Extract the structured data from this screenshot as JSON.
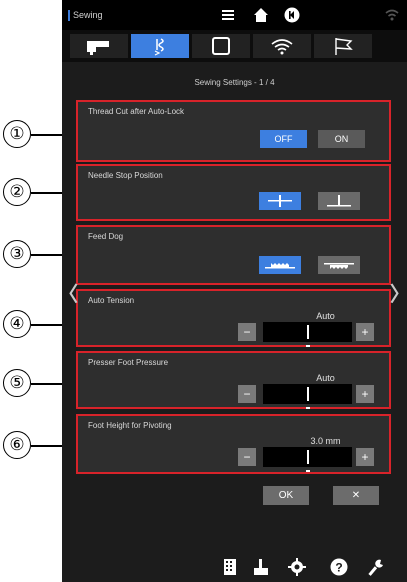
{
  "app": {
    "title": "Sewing"
  },
  "subtitle": "Sewing Settings - 1 / 4",
  "settings": {
    "thread_cut": {
      "label": "Thread Cut after Auto-Lock",
      "off_label": "OFF",
      "on_label": "ON",
      "selected": "OFF"
    },
    "needle_stop": {
      "label": "Needle Stop Position",
      "selected": "up"
    },
    "feed_dog": {
      "label": "Feed Dog",
      "selected": "up"
    },
    "auto_tension": {
      "label": "Auto Tension",
      "value": "Auto",
      "minus": "−",
      "plus": "+"
    },
    "presser_foot": {
      "label": "Presser Foot Pressure",
      "value": "Auto",
      "minus": "−",
      "plus": "+"
    },
    "foot_height": {
      "label": "Foot Height for Pivoting",
      "value": "3.0 mm",
      "minus": "−",
      "plus": "+"
    }
  },
  "buttons": {
    "ok": "OK",
    "close": "✕"
  },
  "nav": {
    "prev": "〈",
    "next": "〉"
  },
  "callouts": [
    "①",
    "②",
    "③",
    "④",
    "⑤",
    "⑥"
  ],
  "icons": {
    "top": [
      "menu-icon",
      "home-icon",
      "back-icon",
      "wifi-icon"
    ],
    "tabs": [
      "sewing-machine-icon",
      "stitch-icon",
      "frame-icon",
      "wifi-icon",
      "flag-icon"
    ],
    "bottom": [
      "pattern-icon",
      "thread-spool-icon",
      "settings-icon",
      "help-icon",
      "wrench-icon"
    ]
  },
  "colors": {
    "accent": "#3d7fe0",
    "highlight": "#d8232a",
    "background": "#1c1c1c"
  }
}
